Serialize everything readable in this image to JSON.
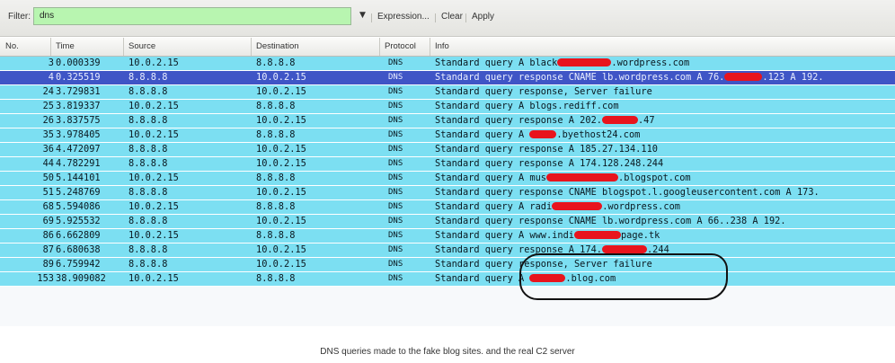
{
  "toolbar": {
    "filter_label": "Filter:",
    "filter_value": "dns",
    "dropdown_glyph": "▼",
    "expression_label": "Expression...",
    "clear_label": "Clear",
    "apply_label": "Apply"
  },
  "columns": {
    "no": "No.",
    "time": "Time",
    "source": "Source",
    "destination": "Destination",
    "protocol": "Protocol",
    "info": "Info"
  },
  "rows": [
    {
      "no": "3",
      "time": "0.000339",
      "src": "10.0.2.15",
      "dst": "8.8.8.8",
      "proto": "DNS",
      "info_pre": "Standard query A black",
      "info_post": ".wordpress.com",
      "selected": false
    },
    {
      "no": "4",
      "time": "0.325519",
      "src": "8.8.8.8",
      "dst": "10.0.2.15",
      "proto": "DNS",
      "info_pre": "Standard query response CNAME lb.wordpress.com A 76.",
      "info_post": ".123 A 192.",
      "selected": true
    },
    {
      "no": "24",
      "time": "3.729831",
      "src": "8.8.8.8",
      "dst": "10.0.2.15",
      "proto": "DNS",
      "info_pre": "Standard query response, Server failure",
      "info_post": "",
      "selected": false
    },
    {
      "no": "25",
      "time": "3.819337",
      "src": "10.0.2.15",
      "dst": "8.8.8.8",
      "proto": "DNS",
      "info_pre": "Standard query A blogs.rediff.com",
      "info_post": "",
      "selected": false
    },
    {
      "no": "26",
      "time": "3.837575",
      "src": "8.8.8.8",
      "dst": "10.0.2.15",
      "proto": "DNS",
      "info_pre": "Standard query response A 202.",
      "info_post": ".47",
      "selected": false
    },
    {
      "no": "35",
      "time": "3.978405",
      "src": "10.0.2.15",
      "dst": "8.8.8.8",
      "proto": "DNS",
      "info_pre": "Standard query A ",
      "info_post": ".byethost24.com",
      "selected": false
    },
    {
      "no": "36",
      "time": "4.472097",
      "src": "8.8.8.8",
      "dst": "10.0.2.15",
      "proto": "DNS",
      "info_pre": "Standard query response A 185.27.134.110",
      "info_post": "",
      "selected": false
    },
    {
      "no": "44",
      "time": "4.782291",
      "src": "8.8.8.8",
      "dst": "10.0.2.15",
      "proto": "DNS",
      "info_pre": "Standard query response A 174.128.248.244",
      "info_post": "",
      "selected": false
    },
    {
      "no": "50",
      "time": "5.144101",
      "src": "10.0.2.15",
      "dst": "8.8.8.8",
      "proto": "DNS",
      "info_pre": "Standard query A mus",
      "info_post": ".blogspot.com",
      "selected": false
    },
    {
      "no": "51",
      "time": "5.248769",
      "src": "8.8.8.8",
      "dst": "10.0.2.15",
      "proto": "DNS",
      "info_pre": "Standard query response CNAME blogspot.l.googleusercontent.com A 173.",
      "info_post": "",
      "selected": false
    },
    {
      "no": "68",
      "time": "5.594086",
      "src": "10.0.2.15",
      "dst": "8.8.8.8",
      "proto": "DNS",
      "info_pre": "Standard query A radi",
      "info_post": ".wordpress.com",
      "selected": false
    },
    {
      "no": "69",
      "time": "5.925532",
      "src": "8.8.8.8",
      "dst": "10.0.2.15",
      "proto": "DNS",
      "info_pre": "Standard query response CNAME lb.wordpress.com A 66.",
      "info_post": ".238 A 192.",
      "selected": false
    },
    {
      "no": "86",
      "time": "6.662809",
      "src": "10.0.2.15",
      "dst": "8.8.8.8",
      "proto": "DNS",
      "info_pre": "Standard query A www.indi",
      "info_post": "page.tk",
      "selected": false
    },
    {
      "no": "87",
      "time": "6.680638",
      "src": "8.8.8.8",
      "dst": "10.0.2.15",
      "proto": "DNS",
      "info_pre": "Standard query response A 174.",
      "info_post": ".244",
      "selected": false
    },
    {
      "no": "89",
      "time": "6.759942",
      "src": "8.8.8.8",
      "dst": "10.0.2.15",
      "proto": "DNS",
      "info_pre": "Standard query response, Server failure",
      "info_post": "",
      "selected": false
    },
    {
      "no": "153",
      "time": "38.909082",
      "src": "10.0.2.15",
      "dst": "8.8.8.8",
      "proto": "DNS",
      "info_pre": "Standard query A ",
      "info_post": ".blog.com",
      "selected": false
    }
  ],
  "caption": "DNS queries made to the fake blog sites.  and the real C2 server",
  "colors": {
    "row_bg": "#7cdff2",
    "selected_bg": "#3f55c6",
    "filter_bg": "#b8f5b0",
    "redaction": "#e8141d"
  }
}
